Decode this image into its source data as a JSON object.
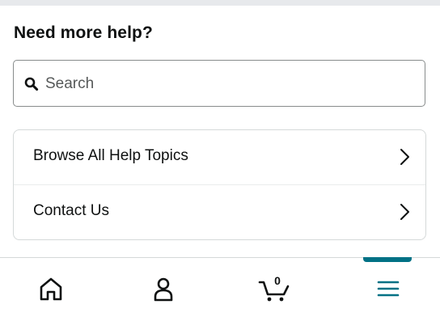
{
  "help_section": {
    "title": "Need more help?",
    "search": {
      "placeholder": "Search",
      "value": ""
    },
    "links": [
      {
        "label": "Browse All Help Topics"
      },
      {
        "label": "Contact Us"
      }
    ]
  },
  "bottom_nav": {
    "items": [
      {
        "icon": "home-icon"
      },
      {
        "icon": "account-icon"
      },
      {
        "icon": "cart-icon",
        "count": "0"
      },
      {
        "icon": "menu-icon",
        "active": true
      }
    ],
    "active_color": "#007185"
  }
}
